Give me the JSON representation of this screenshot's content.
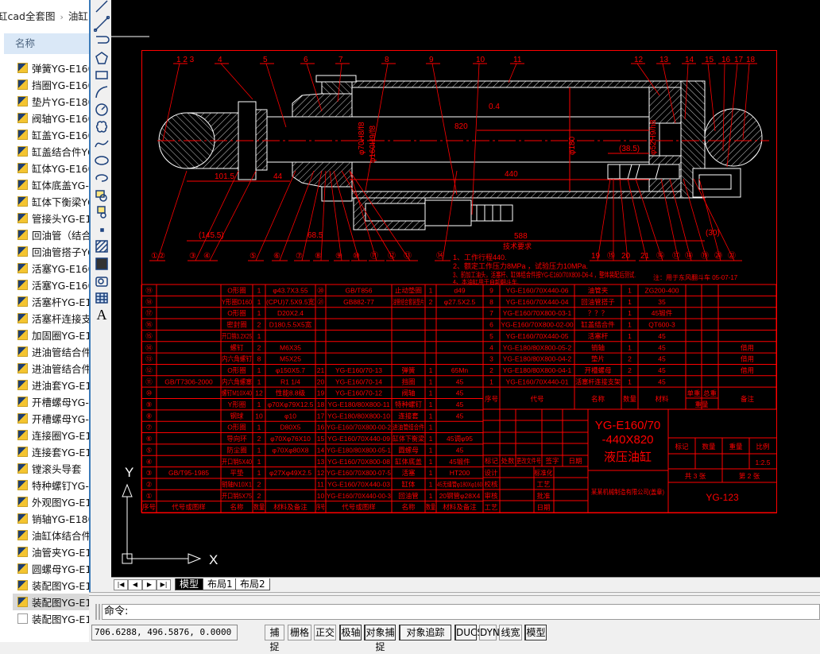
{
  "explorer": {
    "breadcrumb": [
      "缸cad全套图",
      "油缸"
    ],
    "breadcrumb_sep": "›",
    "column_header": "名称",
    "files": [
      "弹簧YG-E160",
      "挡圈YG-E160",
      "垫片YG-E180",
      "阀轴YG-E160",
      "缸盖YG-E160",
      "缸盖结合件YG",
      "缸体YG-E160",
      "缸体底盖YG-E",
      "缸体下衡梁YG",
      "管接头YG-E1",
      "回油管（结合",
      "回油管搭子YG",
      "活塞YG-E160",
      "活塞YG-E160",
      "活塞杆YG-E1",
      "活塞杆连接支",
      "加固圈YG-E1",
      "进油管结合件",
      "进油管结合件",
      "进油套YG-E1",
      "开槽螺母YG-E",
      "开槽螺母YG-E",
      "连接圈YG-E1",
      "连接套YG-E1",
      "镗滚头导套",
      "特种螺钉YG-E",
      "外观图YG-E1",
      "销轴YG-E180",
      "油缸体结合件",
      "油管夹YG-E1",
      "圆螺母YG-E1",
      "装配图YG-E1",
      "装配图YG-E1",
      "装配图YG-E1"
    ],
    "selected_index": 32
  },
  "toolbar": {
    "tools": [
      "line-icon",
      "construction-line-icon",
      "polyline-icon",
      "polygon-icon",
      "rectangle-icon",
      "arc-icon",
      "circle-icon",
      "revision-cloud-icon",
      "spline-icon",
      "ellipse-icon",
      "ellipse-arc-icon",
      "insert-block-icon",
      "make-block-icon",
      "point-icon",
      "hatch-icon",
      "gradient-icon",
      "region-icon",
      "table-icon",
      "multiline-text-icon"
    ],
    "text_tool_label": "A"
  },
  "drawing": {
    "colors": {
      "background": "#000000",
      "annotation": "#ff0000",
      "geometry": "#ffffff"
    },
    "top_balloons": [
      "1 2 3",
      "4",
      "5",
      "6",
      "7",
      "8",
      "9",
      "10",
      "11",
      "12",
      "13",
      "14",
      "15",
      "16",
      "17",
      "18"
    ],
    "bottom_balloons": [
      "①②",
      "③",
      "④",
      "⑤",
      "⑥",
      "⑦",
      "⑧",
      "⑨",
      "⑩",
      "⑪",
      "⑫",
      "⑬",
      "⑭",
      "19",
      "⑮",
      "20",
      "21",
      "⑯",
      "⑰",
      "⑱",
      "⑲",
      "⑳",
      "㉑"
    ],
    "dimensions": {
      "d1": "101.5",
      "d2": "44",
      "d3": "(145.5)",
      "d4": "68.5",
      "d5": "588",
      "d6": "440",
      "d7": "820",
      "d8": "(38.5)",
      "d9": "(30)",
      "fit1": "φ70H8/f8",
      "fit2": "φ160H9/f8",
      "fit3": "φ180",
      "fit4": "φ52H9/h8",
      "rough": "0.4"
    },
    "notes_title": "技术要求",
    "notes": [
      "1、工作行程440.",
      "2、额定工作压力8MPa ，试验压力10MPa.",
      "3、前加工油头，活塞杆、缸体结合件按YG-E160/70X800-D6-4 ，整体装配后测试.",
      "4、本油缸用于自卸翻斗车."
    ],
    "side_note": "注：用于东风翻斗车 05-07-17",
    "ucs": {
      "x": "X",
      "y": "Y"
    }
  },
  "bom_left": {
    "header": [
      "序号",
      "代号或图样",
      "名称",
      "数量",
      "材料及备注",
      "序号",
      "代号或图样",
      "名称",
      "数量",
      "材料及备注"
    ],
    "rows": [
      [
        "⑲",
        "",
        "O形圈",
        "1",
        "φ43.7X3.55",
        "⑳",
        "GB/T856",
        "止动垫圈",
        "1",
        "d49"
      ],
      [
        "⑱",
        "",
        "Y形圈D160",
        "1",
        "(CPU)7.5X9.5宽",
        "㉑",
        "GB882-77",
        "油管结合套装垫片",
        "2",
        "φ27.5X2.5"
      ],
      [
        "⑰",
        "",
        "O形圈",
        "1",
        "D20X2.4",
        "",
        "",
        "",
        "",
        ""
      ],
      [
        "⑯",
        "",
        "密封圈",
        "2",
        "D180,5.5X5宽",
        "",
        "",
        "",
        "",
        ""
      ],
      [
        "⑮",
        "",
        "开口销3.2X25",
        "1",
        "",
        "",
        "",
        "",
        "",
        ""
      ],
      [
        "⑭",
        "",
        "螺钉",
        "2",
        "M6X35",
        "",
        "",
        "",
        "",
        ""
      ],
      [
        "⑬",
        "",
        "内六角螺钉",
        "8",
        "M5X25",
        "",
        "",
        "",
        "",
        ""
      ],
      [
        "⑫",
        "",
        "O形圈",
        "1",
        "φ150X5.7",
        "21",
        "YG-E160/70-13",
        "弹簧",
        "1",
        "65Mn"
      ],
      [
        "⑪",
        "GB/T7306-2000",
        "内六角螺塞",
        "1",
        "R1 1/4",
        "20",
        "YG-E160/70-14",
        "挡圈",
        "1",
        "45"
      ],
      [
        "⑩",
        "",
        "螺钉M10X40",
        "12",
        "性能8.8级",
        "19",
        "YG-E160/70-12",
        "阀轴",
        "1",
        "45"
      ],
      [
        "⑨",
        "",
        "Y形圈",
        "1",
        "φ70Xφ79X12.5",
        "18",
        "YG-E180/80X800-11",
        "特种螺钉",
        "1",
        "45"
      ],
      [
        "⑧",
        "",
        "钢球",
        "10",
        "φ10",
        "17",
        "YG-E180/80X800-10",
        "连接套",
        "1",
        "45"
      ],
      [
        "⑦",
        "",
        "O形圈",
        "1",
        "D80X5",
        "16",
        "YG-E160/70X800-00-2",
        "进油管结合件",
        "1",
        ""
      ],
      [
        "⑥",
        "",
        "导向环",
        "2",
        "φ70Xφ76X10",
        "15",
        "YG-E160/70X440-09",
        "缸体下衡梁",
        "1",
        "45调φ95"
      ],
      [
        "⑤",
        "",
        "防尘圈",
        "1",
        "φ70Xφ80X8",
        "14",
        "YG-E180/80X800-05-1",
        "圆螺母",
        "1",
        "45"
      ],
      [
        "④",
        "",
        "开口销5X40",
        "1",
        "",
        "13",
        "YG-E160/70X800-08",
        "缸体底盖",
        "1",
        "45锻件"
      ],
      [
        "③",
        "GB/T95-1985",
        "平垫",
        "1",
        "φ27Xφ49X2.5",
        "12",
        "YG-E160/70X800-07-5",
        "活塞",
        "1",
        "HT200"
      ],
      [
        "②",
        "",
        "销轴N10X1",
        "2",
        "",
        "11",
        "YG-E160/70X440-03",
        "缸体",
        "1",
        "45无缝管φ180Xφ160"
      ],
      [
        "①",
        "",
        "开口销5X75",
        "2",
        "",
        "10",
        "YG-E160/70X440-00-3",
        "回油管",
        "1",
        "20钢管φ28X4"
      ]
    ]
  },
  "bom_right": {
    "header": [
      "序号",
      "代号",
      "名称",
      "数量",
      "材料",
      "单重",
      "总重",
      "备注"
    ],
    "header_sub": "重量",
    "rows": [
      [
        "9",
        "YG-E160/70X440-06",
        "油管夹",
        "1",
        "ZG200-400",
        "",
        "",
        ""
      ],
      [
        "8",
        "YG-E160/70X440-04",
        "回油管搭子",
        "1",
        "35",
        "",
        "",
        ""
      ],
      [
        "7",
        "YG-E160/70X800-03-1",
        "？？？",
        "1",
        "45锻件",
        "",
        "",
        ""
      ],
      [
        "6",
        "YG-E160/70X800-02-00",
        "缸盖结合件",
        "1",
        "QT600-3",
        "",
        "",
        ""
      ],
      [
        "5",
        "YG-E160/70X440-05",
        "活塞杆",
        "1",
        "45",
        "",
        "",
        ""
      ],
      [
        "4",
        "YG-E180/80X800-05-2",
        "销轴",
        "1",
        "45",
        "",
        "",
        "借用"
      ],
      [
        "3",
        "YG-E180/80X800-04-2",
        "垫片",
        "2",
        "45",
        "",
        "",
        "借用"
      ],
      [
        "2",
        "YG-E180/80X800-04-1",
        "开槽螺母",
        "2",
        "45",
        "",
        "",
        "借用"
      ],
      [
        "1",
        "YG-E160/70X440-01",
        "活塞杆连接支架",
        "1",
        "45",
        "",
        "",
        ""
      ]
    ]
  },
  "title_block": {
    "title_line1": "YG-E160/70",
    "title_line2": "-440X820",
    "title_name": "液压油缸",
    "company": "某某机械制造有限公司(盖章)",
    "change_labels": [
      "标记",
      "处数",
      "更改文件号",
      "签字",
      "日期"
    ],
    "sign_left": [
      "设计",
      "校核",
      "审核",
      "工艺"
    ],
    "sign_right": [
      "标准化",
      "工艺",
      "批准",
      "日期"
    ],
    "stage_labels": [
      "标记",
      "数量",
      "重量",
      "比例"
    ],
    "scale": "1:2.5",
    "sheets_total": "共 3 张",
    "sheet_no": "第 2 张",
    "drawing_no": "YG-123"
  },
  "layout_tabs": {
    "nav": [
      "|◀",
      "◀",
      "▶",
      "▶|"
    ],
    "tabs": [
      "模型",
      "布局1",
      "布局2"
    ],
    "active": "模型"
  },
  "command": {
    "prompt": "命令:",
    "value": ""
  },
  "status": {
    "coordinates": "706.6288,  496.5876, 0.0000",
    "toggles": [
      {
        "label": "捕捉",
        "on": false
      },
      {
        "label": "栅格",
        "on": false
      },
      {
        "label": "正交",
        "on": false
      },
      {
        "label": "极轴",
        "on": true
      },
      {
        "label": "对象捕捉",
        "on": true
      },
      {
        "label": "对象追踪",
        "on": true
      },
      {
        "label": "DUCS",
        "on": true
      },
      {
        "label": "DYN",
        "on": false
      },
      {
        "label": "线宽",
        "on": false
      },
      {
        "label": "模型",
        "on": true
      }
    ]
  }
}
